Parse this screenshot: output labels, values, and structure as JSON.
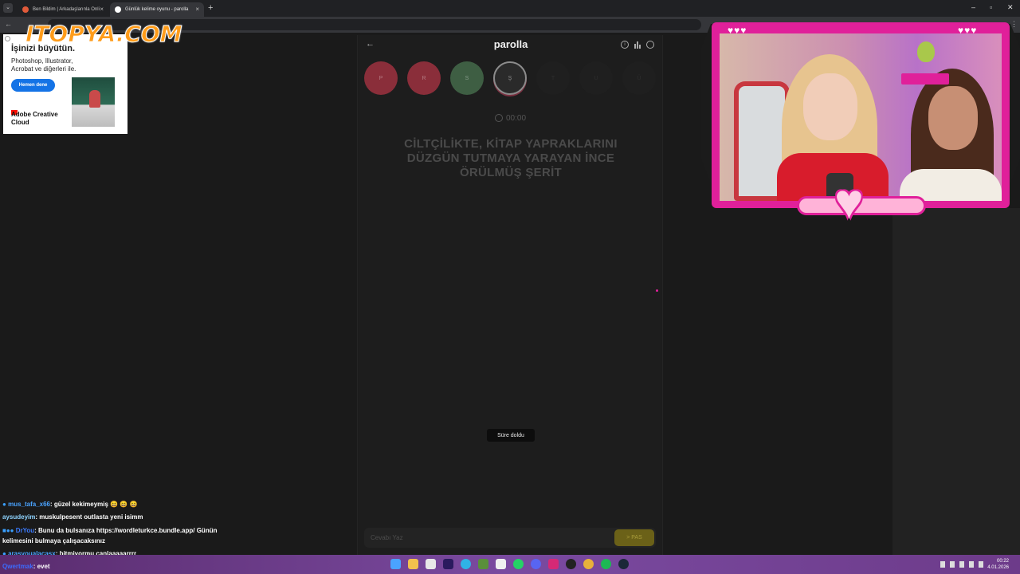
{
  "browser": {
    "tabs": [
      {
        "label": "Ben Bildim | Arkadaşlarınla Onli"
      },
      {
        "label": "Günlük kelime oyunu - parolla"
      }
    ],
    "new_tab": "+",
    "close": "×"
  },
  "ad": {
    "headline": "İşinizi büyütün.",
    "body": "Photoshop, Illustrator, Acrobat ve diğerleri ile.",
    "cta": "Hemen dene",
    "brand": "Adobe Creative Cloud"
  },
  "overlay": {
    "logo": "ITOPYA.COM"
  },
  "game": {
    "title": "parolla",
    "letters": [
      "P",
      "R",
      "S",
      "Ş",
      "T",
      "U",
      "Ü"
    ],
    "timer": "00:00",
    "clue": "CİLTÇİLİKTE, KİTAP YAPRAKLARINI DÜZGÜN TUTMAYA YARAYAN İNCE ÖRÜLMÜŞ ŞERİT",
    "toast": "Süre doldu",
    "answer_placeholder": "Cevabı Yaz",
    "pass_label": "> PAS",
    "colors": {
      "wrong": "#8a2e3a",
      "correct": "#3e5e43",
      "pass_btn": "#6b6118"
    }
  },
  "chat": [
    {
      "user": "mus_tafa_x66",
      "user_color": "#4aa3ff",
      "text": ": güzel kekimeymiş 😄 😄 😄"
    },
    {
      "user": "aysudeyim",
      "user_color": "#8fd4ff",
      "text": ": muskulpesent outlasta yeni isimm"
    },
    {
      "user": "DrYou",
      "user_color": "#3b7bff",
      "text": ": Bunu da bulsanıza https://wordleturkce.bundle.app/ Günün"
    },
    {
      "user": "",
      "user_color": "#ffffff",
      "text": "kelimesini bulmaya çalışacaksınız"
    },
    {
      "user": "arasyoualacasx",
      "user_color": "#4aa3ff",
      "text": ": bitmiyormu canlaaaaarrrr"
    },
    {
      "user": "Qwertmak",
      "user_color": "#3b6bff",
      "text": ": evet"
    }
  ],
  "taskbar": {
    "time": "00:22",
    "date": "4.01.2026"
  }
}
